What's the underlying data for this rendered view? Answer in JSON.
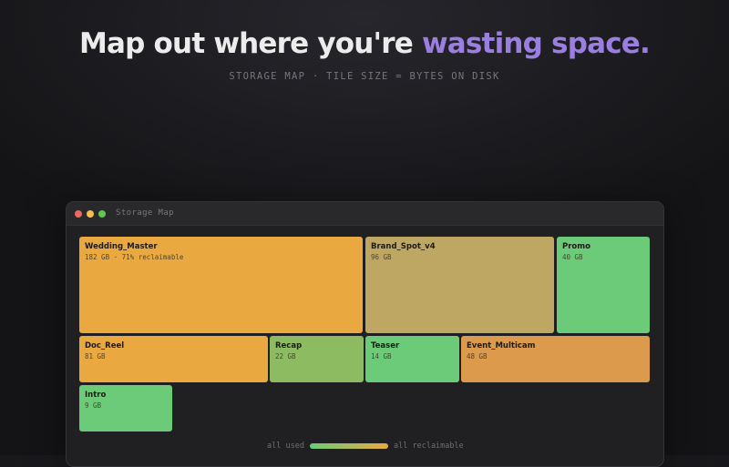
{
  "headline": {
    "prefix": "Map out where you're ",
    "accent": "wasting space.",
    "accent_color": "#9b7fe0"
  },
  "subtitle": "STORAGE MAP · TILE SIZE = BYTES ON DISK",
  "window": {
    "title": "Storage Map",
    "traffic_lights": {
      "close": "#ec6a5e",
      "minimize": "#f4bf4f",
      "maximize": "#61c554"
    }
  },
  "tiles": [
    {
      "name": "Wedding_Master",
      "size": "182 GB · 71% reclaimable",
      "color": "#eaa940",
      "bytes_gb": 182
    },
    {
      "name": "Brand_Spot_v4",
      "size": "96 GB",
      "color": "#bea762",
      "bytes_gb": 96
    },
    {
      "name": "Promo",
      "size": "40 GB",
      "color": "#6bcb78",
      "bytes_gb": 40
    },
    {
      "name": "Doc_Reel",
      "size": "81 GB",
      "color": "#eaa940",
      "bytes_gb": 81
    },
    {
      "name": "Recap",
      "size": "22 GB",
      "color": "#8dbb62",
      "bytes_gb": 22
    },
    {
      "name": "Teaser",
      "size": "14 GB",
      "color": "#6bcb78",
      "bytes_gb": 14
    },
    {
      "name": "Event_Multicam",
      "size": "48 GB",
      "color": "#db9a4c",
      "bytes_gb": 48
    },
    {
      "name": "Intro",
      "size": "9 GB",
      "color": "#6bcb78",
      "bytes_gb": 9
    }
  ],
  "legend": {
    "left_label": "all used",
    "right_label": "all reclaimable",
    "gradient_from": "#6bcb78",
    "gradient_to": "#eaa940"
  }
}
